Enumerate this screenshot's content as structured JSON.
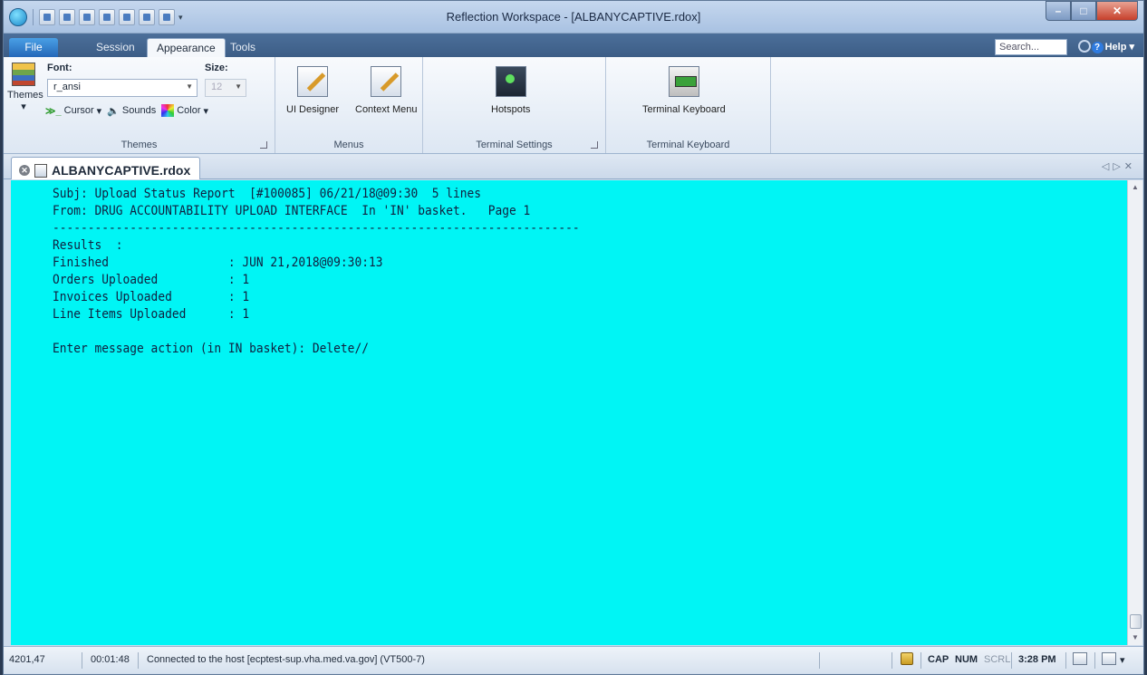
{
  "window": {
    "title": "Reflection Workspace - [ALBANYCAPTIVE.rdox]",
    "minimize": "–",
    "maximize": "□",
    "close": "✕"
  },
  "ribbon_tabs": [
    {
      "label": "File"
    },
    {
      "label": "Session"
    },
    {
      "label": "Appearance"
    },
    {
      "label": "Tools"
    }
  ],
  "search": {
    "placeholder": "Search..."
  },
  "help": {
    "label": "Help"
  },
  "ribbon": {
    "themes_group": {
      "themes_button": "Themes",
      "font_label": "Font:",
      "font_value": "r_ansi",
      "size_label": "Size:",
      "size_value": "12",
      "cursor_label": "Cursor",
      "sounds_label": "Sounds",
      "color_label": "Color",
      "group_label": "Themes"
    },
    "menus_group": {
      "ui_designer": "UI Designer",
      "context_menu": "Context Menu",
      "group_label": "Menus"
    },
    "terminal_settings_group": {
      "hotspots": "Hotspots",
      "group_label": "Terminal Settings"
    },
    "terminal_keyboard_group": {
      "terminal_keyboard": "Terminal Keyboard",
      "group_label": "Terminal Keyboard"
    }
  },
  "document_tab": {
    "label": "ALBANYCAPTIVE.rdox"
  },
  "terminal": {
    "lines": [
      "Subj: Upload Status Report  [#100085] 06/21/18@09:30  5 lines",
      "From: DRUG ACCOUNTABILITY UPLOAD INTERFACE  In 'IN' basket.   Page 1",
      "---------------------------------------------------------------------------",
      "Results  :",
      "Finished                 : JUN 21,2018@09:30:13",
      "Orders Uploaded          : 1",
      "Invoices Uploaded        : 1",
      "Line Items Uploaded      : 1",
      "",
      "Enter message action (in IN basket): Delete//"
    ],
    "background": "#00f5f5"
  },
  "status_bar": {
    "cursor_position": "4201,47",
    "elapsed": "00:01:48",
    "connection": "Connected to the host [ecptest-sup.vha.med.va.gov] (VT500-7)",
    "cap": "CAP",
    "num": "NUM",
    "scrl": "SCRL",
    "time": "3:28 PM"
  }
}
